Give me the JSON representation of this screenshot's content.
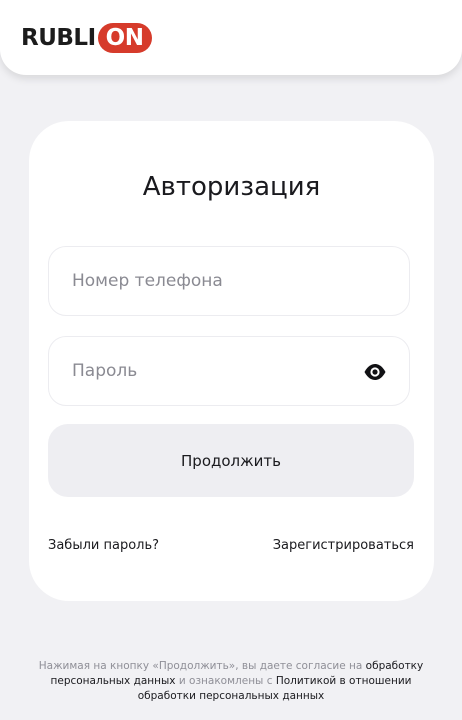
{
  "header": {
    "logo_main": "RUBLI",
    "logo_accent": "ON"
  },
  "auth": {
    "title": "Авторизация",
    "phone_placeholder": "Номер телефона",
    "password_placeholder": "Пароль",
    "continue_label": "Продолжить",
    "forgot_label": "Забыли пароль?",
    "register_label": "Зарегистрироваться"
  },
  "consent": {
    "part1": "Нажимая на кнопку «Продолжить», вы даете согласие на ",
    "link1": "обработку персональных данных",
    "part2": " и ознакомлены с ",
    "link2": "Политикой в отношении обработки персональных данных"
  },
  "icons": {
    "password_toggle": "eye-icon"
  },
  "colors": {
    "brand_red": "#d63b2b",
    "background": "#f1f1f4",
    "card": "#ffffff",
    "button_bg": "#eeeef2"
  }
}
